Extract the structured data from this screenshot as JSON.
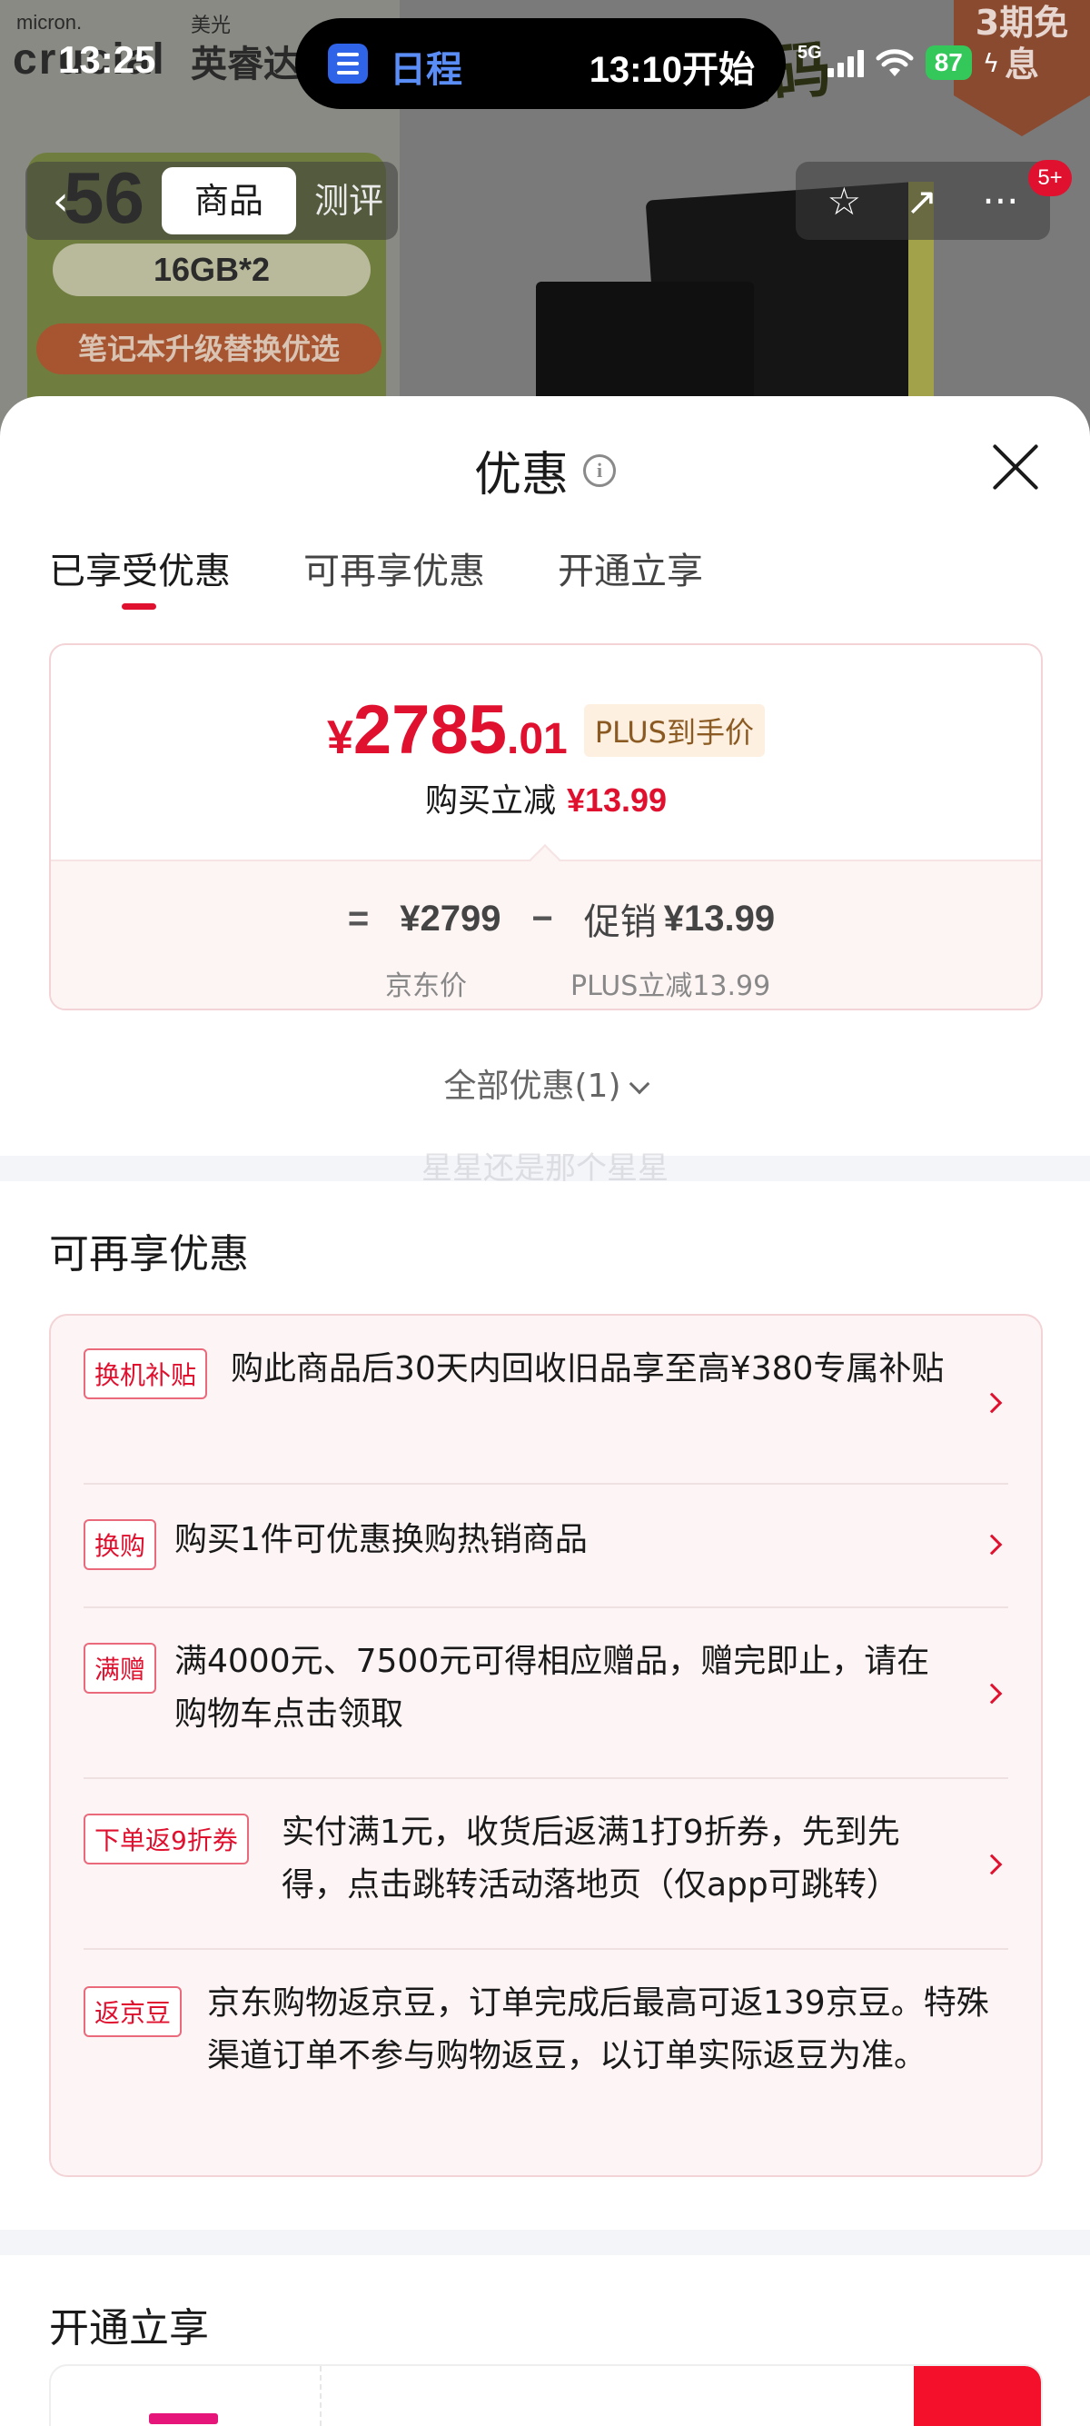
{
  "status_bar": {
    "time": "13:25",
    "activity_app": "日程",
    "activity_text": "13:10开始",
    "network": "5G",
    "battery": "87"
  },
  "background_page": {
    "brand": "micron.",
    "brand_large": "crucial",
    "brand_cn_sub": "美光",
    "brand_cn": "英睿达",
    "spec_number": "56",
    "spec_pill": "16GB*2",
    "promo_pill": "笔记本升级替换优选",
    "promo_title": "数码",
    "corner_badge": "3期免息"
  },
  "product_nav": {
    "back_label": "‹",
    "tab_goods": "商品",
    "tab_review": "测评",
    "star_icon": "☆",
    "share_icon": "↗",
    "more_icon": "···",
    "badge": "5+"
  },
  "sheet": {
    "title": "优惠",
    "info_icon": "i",
    "tabs": [
      "已享受优惠",
      "可再享优惠",
      "开通立享"
    ],
    "active_tab": 0,
    "price": {
      "currency": "¥",
      "integer": "2785",
      "decimal": ".01",
      "plus_tag": "PLUS到手价",
      "reduce_label": "购买立减",
      "reduce_amount": "¥13.99"
    },
    "breakdown": {
      "eq": "=",
      "jd_price": "¥2799",
      "minus": "−",
      "promo_label": "促销",
      "promo_value": "¥13.99",
      "jd_price_label": "京东价",
      "promo_sub": "PLUS立减13.99"
    },
    "all_offers": "全部优惠(1)",
    "watermark": "星星还是那个星星",
    "section_more": "可再享优惠",
    "offers": [
      {
        "tag": "换机补贴",
        "text": "购此商品后30天内回收旧品享至高¥380专属补贴"
      },
      {
        "tag": "换购",
        "text": "购买1件可优惠换购热销商品"
      },
      {
        "tag": "满赠",
        "text": "满4000元、7500元可得相应赠品，赠完即止，请在购物车点击领取"
      },
      {
        "tag": "下单返9折券",
        "text": "实付满1元，收货后返满1打9折券，先到先得，点击跳转活动落地页（仅app可跳转）"
      },
      {
        "tag": "返京豆",
        "text": "京东购物返京豆，订单完成后最高可返139京豆。特殊渠道订单不参与购物返豆，以订单实际返豆为准。"
      }
    ],
    "section_open": "开通立享"
  },
  "colors": {
    "accent_red": "#e0102f",
    "plus_tag_bg": "#fdf0e0",
    "card_border": "#f3d3d6",
    "card_bg": "#fdf5f5",
    "battery_green": "#34c759",
    "island_blue": "#2f63e8"
  }
}
